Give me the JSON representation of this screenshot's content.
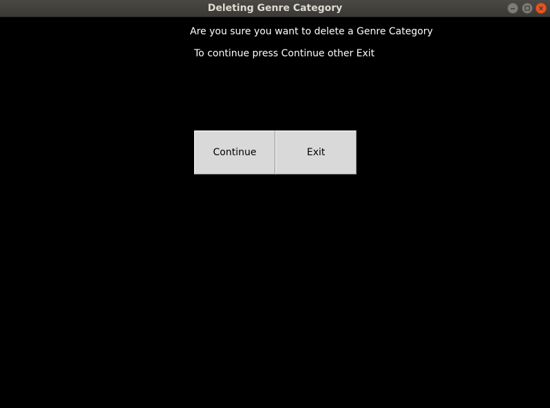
{
  "window": {
    "title": "Deleting Genre Category",
    "controls": {
      "minimize_icon": "minimize-icon",
      "maximize_icon": "maximize-icon",
      "close_icon": "close-icon"
    },
    "colors": {
      "titlebar": "#3c3b37",
      "close_button": "#e95420",
      "background": "#000000"
    }
  },
  "dialog": {
    "question": "Are you sure you want to delete a Genre Category",
    "instruction": "To continue press Continue other Exit",
    "buttons": {
      "continue_label": "Continue",
      "exit_label": "Exit"
    }
  }
}
